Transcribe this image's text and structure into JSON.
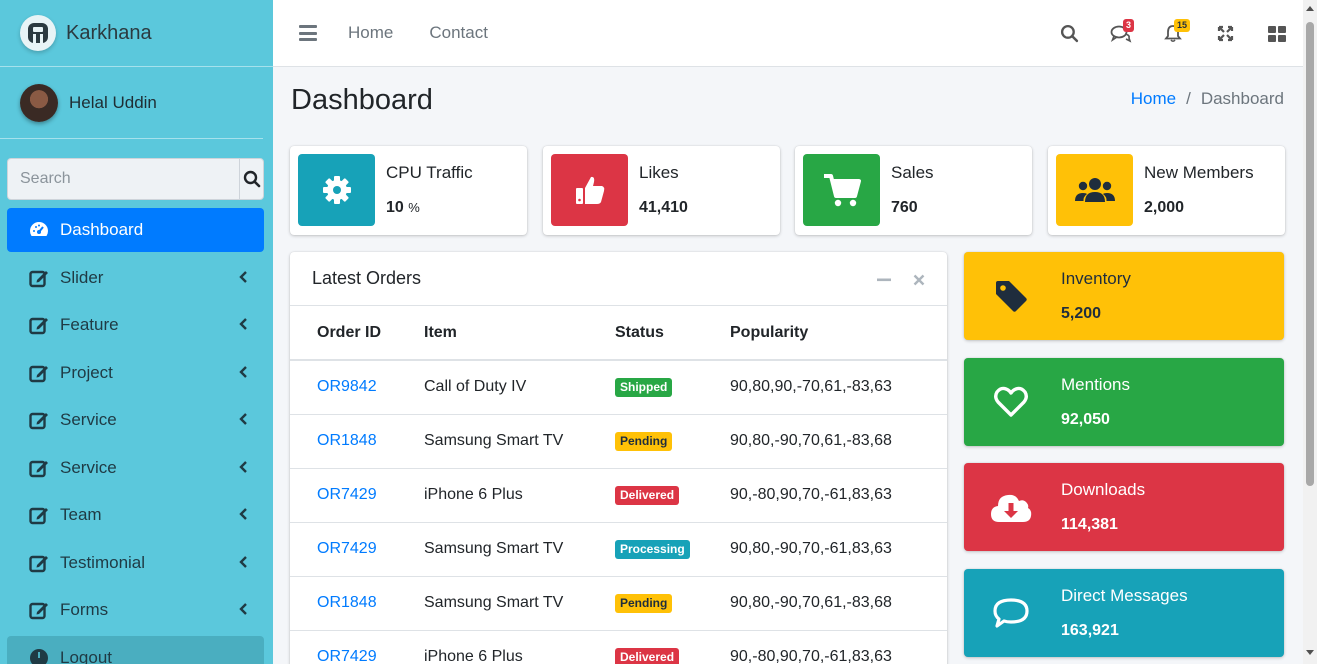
{
  "brand": {
    "name": "Karkhana"
  },
  "user": {
    "name": "Helal Uddin"
  },
  "search": {
    "placeholder": "Search"
  },
  "sidebar": {
    "items": [
      {
        "label": "Dashboard",
        "icon": "tachometer-icon",
        "active": true
      },
      {
        "label": "Slider",
        "icon": "edit-icon"
      },
      {
        "label": "Feature",
        "icon": "edit-icon"
      },
      {
        "label": "Project",
        "icon": "edit-icon"
      },
      {
        "label": "Service",
        "icon": "edit-icon"
      },
      {
        "label": "Service",
        "icon": "edit-icon"
      },
      {
        "label": "Team",
        "icon": "edit-icon"
      },
      {
        "label": "Testimonial",
        "icon": "edit-icon"
      },
      {
        "label": "Forms",
        "icon": "edit-icon"
      },
      {
        "label": "Logout",
        "icon": "power-icon"
      }
    ]
  },
  "topbar": {
    "links": [
      "Home",
      "Contact"
    ],
    "messages_count": "3",
    "notifications_count": "15"
  },
  "page": {
    "title": "Dashboard"
  },
  "breadcrumb": {
    "home": "Home",
    "current": "Dashboard"
  },
  "info_boxes": [
    {
      "label": "CPU Traffic",
      "value": "10",
      "unit": "%",
      "icon": "gear-icon",
      "color": "#17a2b8"
    },
    {
      "label": "Likes",
      "value": "41,410",
      "icon": "thumbs-up-icon",
      "color": "#dc3545"
    },
    {
      "label": "Sales",
      "value": "760",
      "icon": "shopping-cart-icon",
      "color": "#28a745"
    },
    {
      "label": "New Members",
      "value": "2,000",
      "icon": "users-icon",
      "color": "#ffc107"
    }
  ],
  "orders": {
    "title": "Latest Orders",
    "headers": [
      "Order ID",
      "Item",
      "Status",
      "Popularity"
    ],
    "rows": [
      {
        "id": "OR9842",
        "item": "Call of Duty IV",
        "status": "Shipped",
        "popularity": "90,80,90,-70,61,-83,63"
      },
      {
        "id": "OR1848",
        "item": "Samsung Smart TV",
        "status": "Pending",
        "popularity": "90,80,-90,70,61,-83,68"
      },
      {
        "id": "OR7429",
        "item": "iPhone 6 Plus",
        "status": "Delivered",
        "popularity": "90,-80,90,70,-61,83,63"
      },
      {
        "id": "OR7429",
        "item": "Samsung Smart TV",
        "status": "Processing",
        "popularity": "90,80,-90,70,-61,83,63"
      },
      {
        "id": "OR1848",
        "item": "Samsung Smart TV",
        "status": "Pending",
        "popularity": "90,80,-90,70,61,-83,68"
      },
      {
        "id": "OR7429",
        "item": "iPhone 6 Plus",
        "status": "Delivered",
        "popularity": "90,-80,90,70,-61,83,63"
      }
    ]
  },
  "stat_boxes": [
    {
      "label": "Inventory",
      "value": "5,200",
      "icon": "tag-icon",
      "color": "#ffc107"
    },
    {
      "label": "Mentions",
      "value": "92,050",
      "icon": "heart-icon",
      "color": "#28a745"
    },
    {
      "label": "Downloads",
      "value": "114,381",
      "icon": "cloud-download-icon",
      "color": "#dc3545"
    },
    {
      "label": "Direct Messages",
      "value": "163,921",
      "icon": "comment-icon",
      "color": "#17a2b8"
    }
  ]
}
